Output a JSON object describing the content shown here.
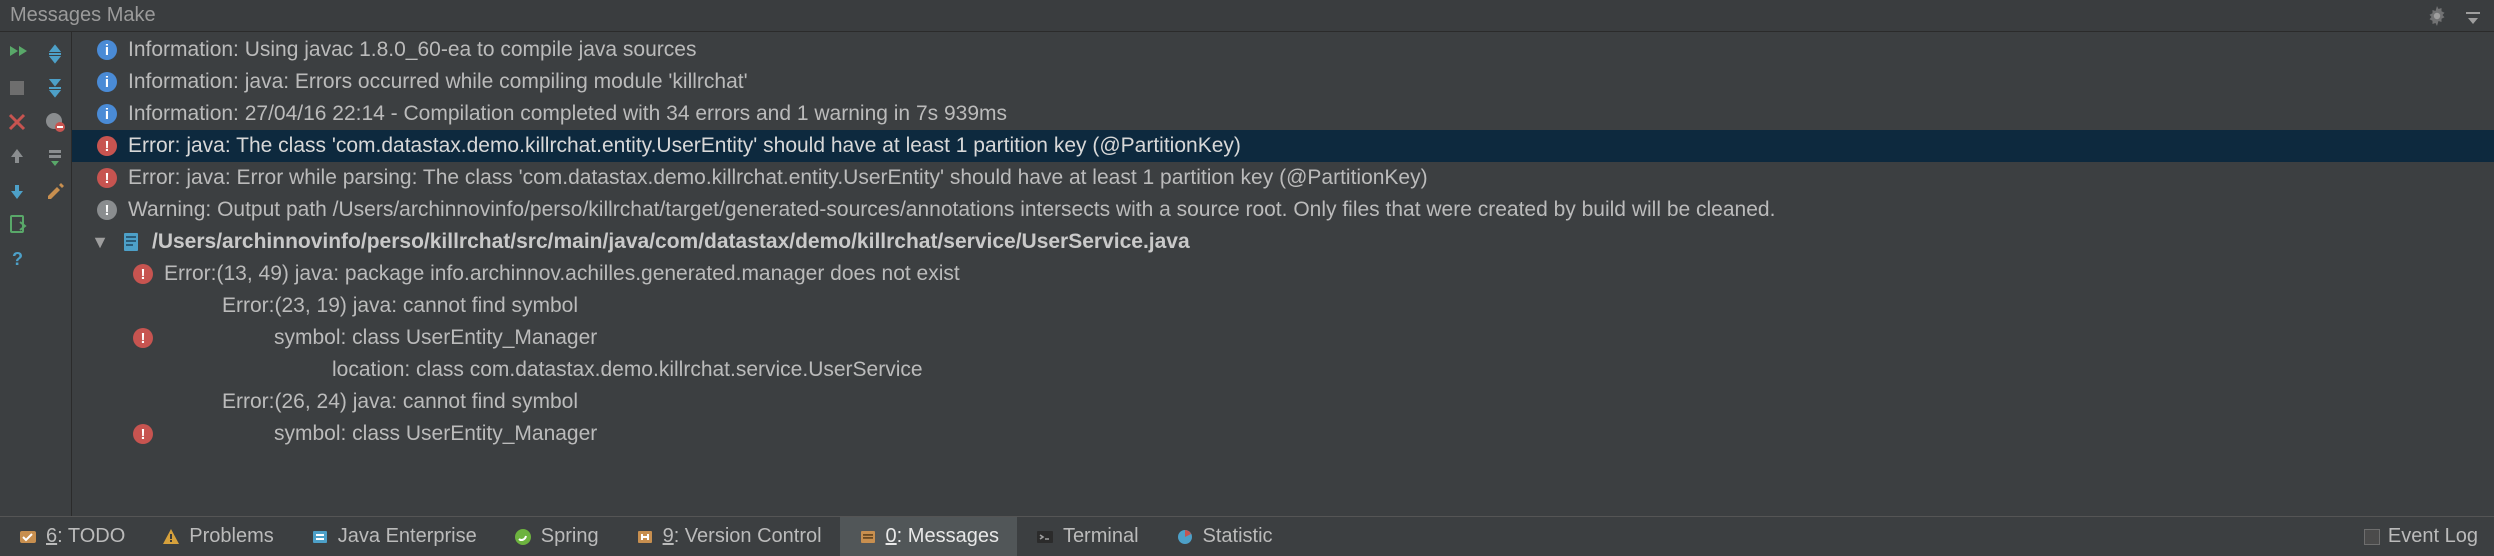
{
  "title": "Messages Make",
  "messages": [
    {
      "kind": "info",
      "text": "Information: Using javac 1.8.0_60-ea to compile java sources"
    },
    {
      "kind": "info",
      "text": "Information: java: Errors occurred while compiling module 'killrchat'"
    },
    {
      "kind": "info",
      "text": "Information: 27/04/16 22:14 - Compilation completed with 34 errors and 1 warning in 7s 939ms"
    },
    {
      "kind": "err",
      "text": "Error: java: The class 'com.datastax.demo.killrchat.entity.UserEntity' should have at least 1 partition key (@PartitionKey)",
      "selected": true
    },
    {
      "kind": "err",
      "text": "Error: java: Error while parsing: The class 'com.datastax.demo.killrchat.entity.UserEntity' should have at least 1 partition key (@PartitionKey)"
    },
    {
      "kind": "warn",
      "text": "Warning: Output path /Users/archinnovinfo/perso/killrchat/target/generated-sources/annotations intersects with a source root. Only files that were created by build will be cleaned."
    }
  ],
  "file_path": "/Users/archinnovinfo/perso/killrchat/src/main/java/com/datastax/demo/killrchat/service/UserService.java",
  "sub": [
    {
      "kind": "err",
      "text": "Error:(13, 49)  java: package info.archinnov.achilles.generated.manager does not exist",
      "bullet": true
    },
    {
      "kind": "err",
      "text": "Error:(23, 19)  java: cannot find symbol",
      "bullet": false
    },
    {
      "kind": "",
      "text": "symbol:   class UserEntity_Manager",
      "bullet": true,
      "detail": true
    },
    {
      "kind": "",
      "text": "location: class com.datastax.demo.killrchat.service.UserService",
      "bullet": false,
      "detail": true
    },
    {
      "kind": "err",
      "text": "Error:(26, 24)  java: cannot find symbol",
      "bullet": false
    },
    {
      "kind": "",
      "text": "symbol:   class UserEntity_Manager",
      "bullet": true,
      "detail": true
    }
  ],
  "tabs": {
    "todo": {
      "num": "6",
      "label": ": TODO"
    },
    "problems": "Problems",
    "java_ee": "Java Enterprise",
    "spring": "Spring",
    "vcs": {
      "num": "9",
      "label": ": Version Control"
    },
    "messages": {
      "num": "0",
      "label": ": Messages"
    },
    "terminal": "Terminal",
    "statistic": "Statistic",
    "eventlog": "Event Log"
  }
}
